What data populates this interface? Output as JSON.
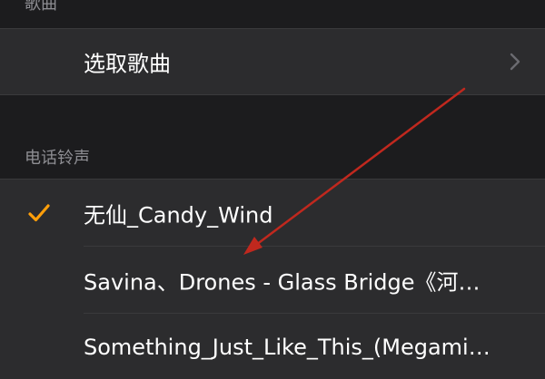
{
  "sections": {
    "songs": {
      "header": "歌曲",
      "choose_label": "选取歌曲"
    },
    "ringtones": {
      "header": "电话铃声",
      "items": [
        {
          "label": "无仙_Candy_Wind",
          "selected": true
        },
        {
          "label": "Savina、Drones - Glass Bridge《河…",
          "selected": false
        },
        {
          "label": "Something_Just_Like_This_(Megami…",
          "selected": false
        }
      ]
    }
  },
  "colors": {
    "background": "#1c1c1e",
    "cell": "#2c2c2e",
    "separator": "#3a3a3c",
    "secondary_text": "#8e8e93",
    "checkmark": "#ff9f0a",
    "annotation_arrow": "#c0281e"
  },
  "icons": {
    "disclosure": "chevron-right-icon",
    "selected": "checkmark-icon"
  }
}
